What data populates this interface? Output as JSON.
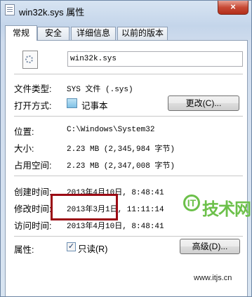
{
  "window": {
    "title": "win32k.sys 属性",
    "close_glyph": "×"
  },
  "tabs": [
    {
      "label": "常规",
      "active": true
    },
    {
      "label": "安全",
      "active": false
    },
    {
      "label": "详细信息",
      "active": false
    },
    {
      "label": "以前的版本",
      "active": false
    }
  ],
  "file": {
    "name": "win32k.sys",
    "icon": "system-file-gear-icon"
  },
  "fields": {
    "type_label": "文件类型:",
    "type_value": "SYS 文件 (.sys)",
    "opens_with_label": "打开方式:",
    "opens_with_value": "记事本",
    "opens_with_icon": "notepad-icon",
    "change_button": "更改(C)...",
    "location_label": "位置:",
    "location_value": "C:\\Windows\\System32",
    "size_label": "大小:",
    "size_value": "2.23 MB (2,345,984 字节)",
    "size_on_disk_label": "占用空间:",
    "size_on_disk_value": "2.23 MB (2,347,008 字节)",
    "created_label": "创建时间:",
    "created_value": "2013年4月10日, 8:48:41",
    "modified_label": "修改时间:",
    "modified_value": "2013年3月1日, 11:11:14",
    "accessed_label": "访问时间:",
    "accessed_value": "2013年4月10日, 8:48:41",
    "attributes_label": "属性:",
    "readonly_label": "只读(R)",
    "readonly_checked": true,
    "advanced_button": "高级(D)..."
  },
  "watermark": {
    "logo_glyph": "IT",
    "brand": "技术网",
    "url": "www.itjs.cn",
    "color": "#6cc04a"
  },
  "colors": {
    "highlight_border": "#9b0a14",
    "close_button": "#c74a35"
  }
}
